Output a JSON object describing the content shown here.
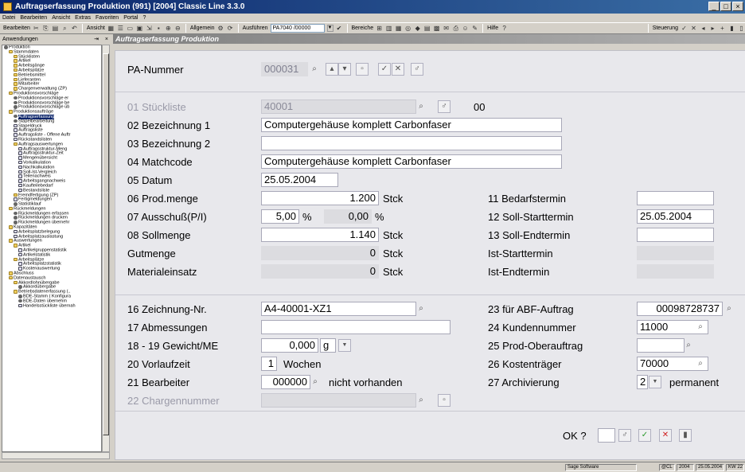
{
  "window": {
    "title": "Auftragserfassung Produktion (991) [2004] Classic Line 3.3.0",
    "controls": [
      "_",
      "□",
      "×"
    ]
  },
  "menu": [
    "Datei",
    "Bearbeiten",
    "Ansicht",
    "Extras",
    "Favoriten",
    "Portal",
    "?"
  ],
  "toolbar": {
    "edit_label": "Bearbeiten",
    "view_label": "Ansicht",
    "general_label": "Allgemein",
    "execute_label": "Ausführen",
    "execute_value": "PA7040 /00000",
    "areas_label": "Bereiche",
    "help_label": "Hilfe",
    "control_label": "Steuerung"
  },
  "leftpanel": {
    "title": "Anwendungen",
    "pin": "⇥",
    "close": "×"
  },
  "tree": [
    {
      "d": 0,
      "i": "gear",
      "t": "Produktion"
    },
    {
      "d": 1,
      "i": "folder",
      "t": "Stammdaten"
    },
    {
      "d": 2,
      "i": "folder",
      "t": "Stücklisten"
    },
    {
      "d": 2,
      "i": "folder",
      "t": "Artikel"
    },
    {
      "d": 2,
      "i": "folder",
      "t": "Arbeitsgänge"
    },
    {
      "d": 2,
      "i": "folder",
      "t": "Arbeitsplätze"
    },
    {
      "d": 2,
      "i": "folder",
      "t": "Betriebsmittel"
    },
    {
      "d": 2,
      "i": "folder",
      "t": "Lieferanten"
    },
    {
      "d": 2,
      "i": "folder",
      "t": "Mitarbeiter"
    },
    {
      "d": 2,
      "i": "folder",
      "t": "Chargenverwaltung (ZP)"
    },
    {
      "d": 1,
      "i": "folder",
      "t": "Produktionsvorschläge"
    },
    {
      "d": 2,
      "i": "gear",
      "t": "Produktionsvorschläge er"
    },
    {
      "d": 2,
      "i": "gear",
      "t": "Produktionsvorschläge be"
    },
    {
      "d": 2,
      "i": "gear",
      "t": "Produktionsvorschläge üb"
    },
    {
      "d": 1,
      "i": "folder",
      "t": "Produktionsaufträge"
    },
    {
      "d": 2,
      "i": "gear",
      "t": "Auftragserfassung",
      "sel": true
    },
    {
      "d": 2,
      "i": "gear",
      "t": "Stapelbearbeitung"
    },
    {
      "d": 2,
      "i": "doc",
      "t": "Stapeldruck"
    },
    {
      "d": 2,
      "i": "doc",
      "t": "Auftragsliste"
    },
    {
      "d": 2,
      "i": "doc",
      "t": "Auftragsliste - Offene Auftr"
    },
    {
      "d": 2,
      "i": "doc",
      "t": "Rückstandslisten"
    },
    {
      "d": 2,
      "i": "folder",
      "t": "Auftragsauswertungen"
    },
    {
      "d": 3,
      "i": "doc",
      "t": "Auftragsstruktur-Meng"
    },
    {
      "d": 3,
      "i": "doc",
      "t": "Auftragsstruktur-Zeit"
    },
    {
      "d": 3,
      "i": "doc",
      "t": "Mengenübersicht"
    },
    {
      "d": 3,
      "i": "doc",
      "t": "Vorkalkulation"
    },
    {
      "d": 3,
      "i": "doc",
      "t": "Nachkalkulation"
    },
    {
      "d": 3,
      "i": "doc",
      "t": "Soll-Ist-Vergleich"
    },
    {
      "d": 3,
      "i": "doc",
      "t": "Teilenachweis"
    },
    {
      "d": 3,
      "i": "doc",
      "t": "Arbeitsgangnachweis"
    },
    {
      "d": 3,
      "i": "doc",
      "t": "Kaufteilebedarf"
    },
    {
      "d": 3,
      "i": "doc",
      "t": "Bestandsliste"
    },
    {
      "d": 2,
      "i": "folder",
      "t": "Fremdfertigung (ZP)"
    },
    {
      "d": 2,
      "i": "doc",
      "t": "Fertigmeldungen"
    },
    {
      "d": 2,
      "i": "gear",
      "t": "Statistiklauf"
    },
    {
      "d": 1,
      "i": "folder",
      "t": "Rückmeldungen"
    },
    {
      "d": 2,
      "i": "gear",
      "t": "Rückmeldungen erfassen"
    },
    {
      "d": 2,
      "i": "gear",
      "t": "Rückmeldungen drucken"
    },
    {
      "d": 2,
      "i": "gear",
      "t": "Rückmeldungen übernehr"
    },
    {
      "d": 1,
      "i": "folder",
      "t": "Kapazitäten"
    },
    {
      "d": 2,
      "i": "doc",
      "t": "Arbeitsplatzbelegung"
    },
    {
      "d": 2,
      "i": "doc",
      "t": "Arbeitsplatzauslastung"
    },
    {
      "d": 1,
      "i": "folder",
      "t": "Auswertungen"
    },
    {
      "d": 2,
      "i": "folder",
      "t": "Artikel"
    },
    {
      "d": 3,
      "i": "doc",
      "t": "Artikelgruppenstatistik"
    },
    {
      "d": 3,
      "i": "doc",
      "t": "Artikelstatistik"
    },
    {
      "d": 2,
      "i": "folder",
      "t": "Arbeitsplätze"
    },
    {
      "d": 3,
      "i": "doc",
      "t": "Arbeitsplatzstatistik"
    },
    {
      "d": 3,
      "i": "doc",
      "t": "Kostenauswertung"
    },
    {
      "d": 1,
      "i": "folder",
      "t": "Abschluss"
    },
    {
      "d": 1,
      "i": "folder",
      "t": "Datenaustausch"
    },
    {
      "d": 2,
      "i": "folder",
      "t": "Akkordlohnübergabe"
    },
    {
      "d": 3,
      "i": "gear",
      "t": "Akkordübergabe"
    },
    {
      "d": 2,
      "i": "folder",
      "t": "Betriebsdatenerfassung (.."
    },
    {
      "d": 3,
      "i": "gear",
      "t": "BDE-Stamm ( Konfigura"
    },
    {
      "d": 3,
      "i": "gear",
      "t": "BDE-Daten übernehm"
    },
    {
      "d": 3,
      "i": "doc",
      "t": "Handelsstückliste übernah"
    }
  ],
  "main": {
    "title": "Auftragserfassung Produktion"
  },
  "form": {
    "pa_label": "PA-Nummer",
    "pa_value": "000031",
    "f01_label": "01 Stückliste",
    "f01_value": "40001",
    "f01_suffix": "00",
    "f02_label": "02 Bezeichnung 1",
    "f02_value": "Computergehäuse komplett Carbonfaser",
    "f03_label": "03 Bezeichnung 2",
    "f03_value": "",
    "f04_label": "04 Matchcode",
    "f04_value": "Computergehäuse komplett Carbonfaser",
    "f05_label": "05 Datum",
    "f05_value": "25.05.2004",
    "f06_label": "06 Prod.menge",
    "f06_value": "1.200",
    "f06_unit": "Stck",
    "f07_label": "07 Ausschuß(P/I)",
    "f07_value": "5,00",
    "f07_unit": "%",
    "f07_value2": "0,00",
    "f07_unit2": "%",
    "f08_label": "08 Sollmenge",
    "f08_value": "1.140",
    "f08_unit": "Stck",
    "gut_label": "Gutmenge",
    "gut_value": "0",
    "gut_unit": "Stck",
    "mat_label": "Materialeinsatz",
    "mat_value": "0",
    "mat_unit": "Stck",
    "f11_label": "11 Bedarfstermin",
    "f11_value": "",
    "f12_label": "12 Soll-Starttermin",
    "f12_value": "25.05.2004",
    "f13_label": "13 Soll-Endtermin",
    "f13_value": "",
    "ist_start_label": "Ist-Starttermin",
    "ist_start_value": "",
    "ist_end_label": "Ist-Endtermin",
    "ist_end_value": "",
    "f16_label": "16 Zeichnung-Nr.",
    "f16_value": "A4-40001-XZ1",
    "f17_label": "17 Abmessungen",
    "f17_value": "",
    "f18_label": "18 - 19 Gewicht/ME",
    "f18_value": "0,000",
    "f18_unit": "g",
    "f20_label": "20 Vorlaufzeit",
    "f20_value": "1",
    "f20_unit": "Wochen",
    "f21_label": "21 Bearbeiter",
    "f21_value": "000000",
    "f21_text": "nicht vorhanden",
    "f22_label": "22 Chargennummer",
    "f22_value": "",
    "f23_label": "23 für ABF-Auftrag",
    "f23_value": "00098728737",
    "f24_label": "24 Kundennummer",
    "f24_value": "11000",
    "f25_label": "25 Prod-Oberauftrag",
    "f25_value": "",
    "f26_label": "26 Kostenträger",
    "f26_value": "70000",
    "f27_label": "27 Archivierung",
    "f27_value": "2",
    "f27_text": "permanent",
    "ok_label": "OK ?",
    "ok_value": ""
  },
  "status": {
    "vendor": "Sage Software",
    "mode": "@CL",
    "year": "2004",
    "date": "25.05.2004",
    "week": "KW 22"
  }
}
